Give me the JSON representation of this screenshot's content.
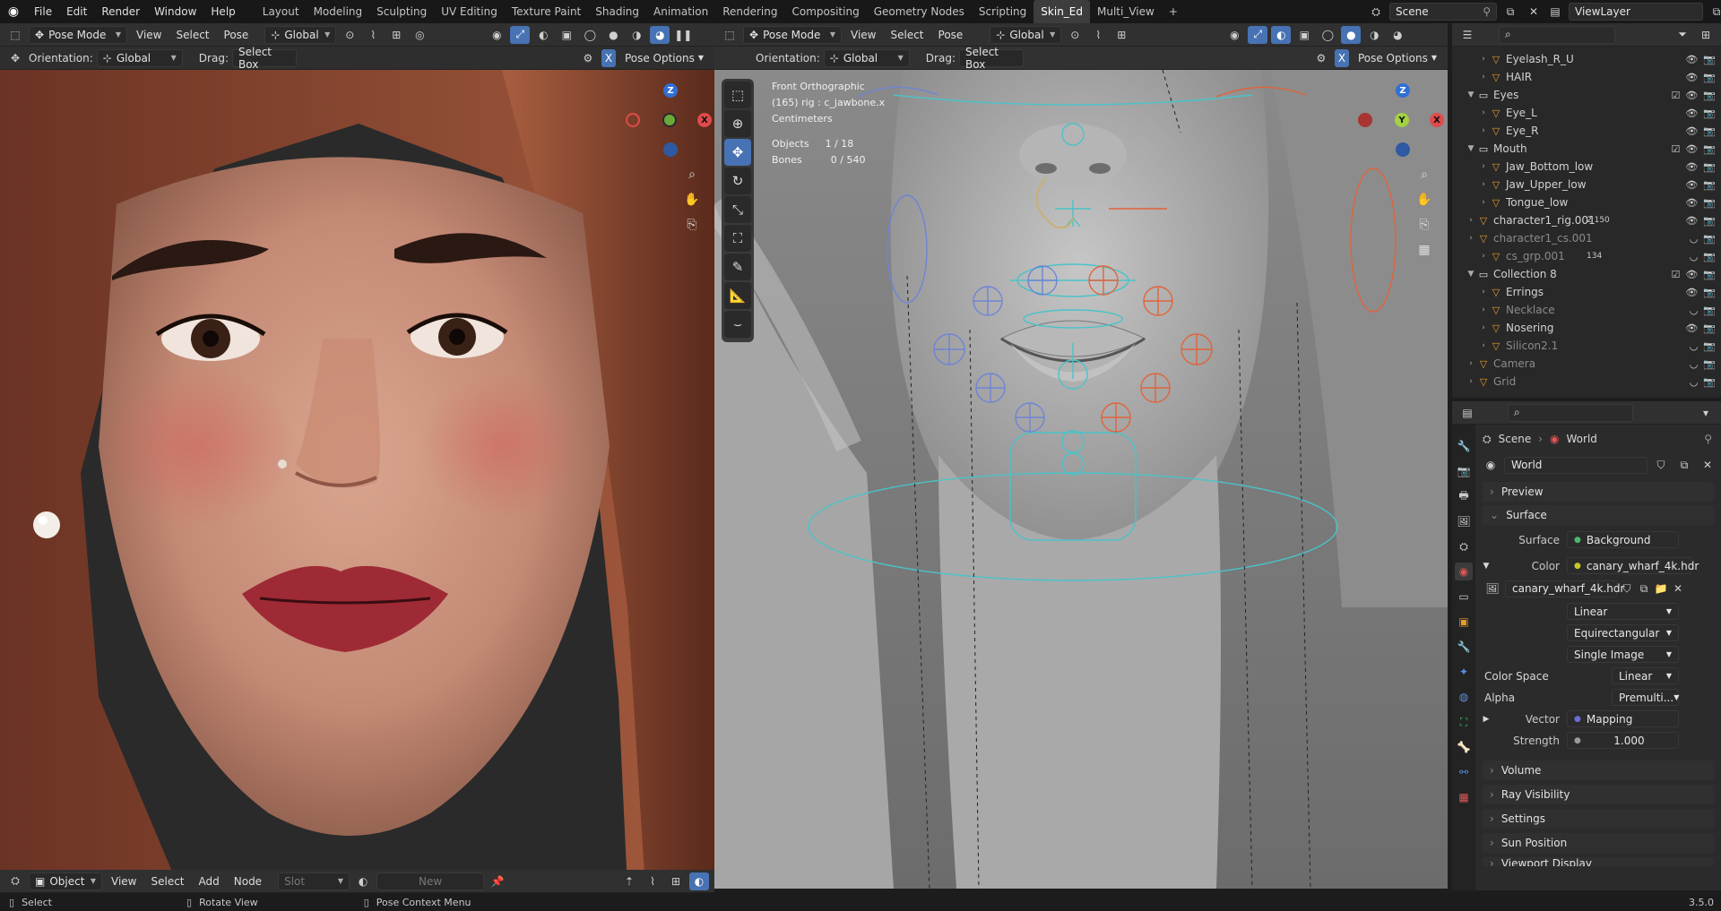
{
  "topbar": {
    "menus": [
      "File",
      "Edit",
      "Render",
      "Window",
      "Help"
    ],
    "workspaces": [
      "Layout",
      "Modeling",
      "Sculpting",
      "UV Editing",
      "Texture Paint",
      "Shading",
      "Animation",
      "Rendering",
      "Compositing",
      "Geometry Nodes",
      "Scripting",
      "Skin_Ed",
      "Multi_View"
    ],
    "active_workspace": "Skin_Ed",
    "add_tab": "+",
    "scene": "Scene",
    "view_layer": "ViewLayer"
  },
  "viewport_left": {
    "mode": "Pose Mode",
    "menus": [
      "View",
      "Select",
      "Pose"
    ],
    "transform": "Global",
    "orientation_label": "Orientation:",
    "orientation_value": "Global",
    "drag_label": "Drag:",
    "drag_value": "Select Box",
    "x_badge": "X",
    "pose_options": "Pose Options"
  },
  "viewport_right": {
    "mode": "Pose Mode",
    "menus": [
      "View",
      "Select",
      "Pose"
    ],
    "transform": "Global",
    "orientation_label": "Orientation:",
    "orientation_value": "Global",
    "drag_label": "Drag:",
    "drag_value": "Select Box",
    "x_badge": "X",
    "pose_options": "Pose Options",
    "overlay": {
      "view": "Front Orthographic",
      "rig": "(165) rig : c_jawbone.x",
      "units": "Centimeters",
      "objects_label": "Objects",
      "objects_value": "1 / 18",
      "bones_label": "Bones",
      "bones_value": "0 / 540"
    }
  },
  "gizmo": {
    "x": "X",
    "y": "Y",
    "z": "Z"
  },
  "node_editor": {
    "type": "Object",
    "menus": [
      "View",
      "Select",
      "Add",
      "Node"
    ],
    "slot": "Slot",
    "new": "New"
  },
  "outliner": {
    "rows": [
      {
        "label": "Eyelash_R_U",
        "indent": 2,
        "dim": false
      },
      {
        "label": "HAIR",
        "indent": 2,
        "dim": false
      },
      {
        "label": "Eyes",
        "indent": 1,
        "dim": false,
        "collection": true
      },
      {
        "label": "Eye_L",
        "indent": 2,
        "dim": false
      },
      {
        "label": "Eye_R",
        "indent": 2,
        "dim": false
      },
      {
        "label": "Mouth",
        "indent": 1,
        "dim": false,
        "collection": true
      },
      {
        "label": "Jaw_Bottom_low",
        "indent": 2,
        "dim": false
      },
      {
        "label": "Jaw_Upper_low",
        "indent": 2,
        "dim": false
      },
      {
        "label": "Tongue_low",
        "indent": 2,
        "dim": false
      },
      {
        "label": "character1_rig.001",
        "indent": 1,
        "dim": false,
        "badge": "2 150"
      },
      {
        "label": "character1_cs.001",
        "indent": 1,
        "dim": true
      },
      {
        "label": "cs_grp.001",
        "indent": 2,
        "dim": true,
        "badge": "134"
      },
      {
        "label": "Collection 8",
        "indent": 1,
        "dim": false,
        "collection": true
      },
      {
        "label": "Errings",
        "indent": 2,
        "dim": false
      },
      {
        "label": "Necklace",
        "indent": 2,
        "dim": true
      },
      {
        "label": "Nosering",
        "indent": 2,
        "dim": false
      },
      {
        "label": "Silicon2.1",
        "indent": 2,
        "dim": true
      },
      {
        "label": "Camera",
        "indent": 1,
        "dim": true
      },
      {
        "label": "Grid",
        "indent": 1,
        "dim": true
      }
    ]
  },
  "properties": {
    "breadcrumb_scene": "Scene",
    "breadcrumb_world": "World",
    "world_name": "World",
    "preview": "Preview",
    "surface": "Surface",
    "surface_label": "Surface",
    "surface_value": "Background",
    "color_label": "Color",
    "color_value": "canary_wharf_4k.hdr",
    "image_name": "canary_wharf_4k.hdr",
    "interp": "Linear",
    "projection": "Equirectangular",
    "source": "Single Image",
    "color_space_label": "Color Space",
    "color_space_value": "Linear",
    "alpha_label": "Alpha",
    "alpha_value": "Premulti...",
    "vector_label": "Vector",
    "vector_value": "Mapping",
    "strength_label": "Strength",
    "strength_value": "1.000",
    "panels": [
      "Volume",
      "Ray Visibility",
      "Settings",
      "Sun Position",
      "Viewport Display"
    ]
  },
  "statusbar": {
    "select": "Select",
    "rotate": "Rotate View",
    "context": "Pose Context Menu",
    "version": "3.5.0"
  }
}
